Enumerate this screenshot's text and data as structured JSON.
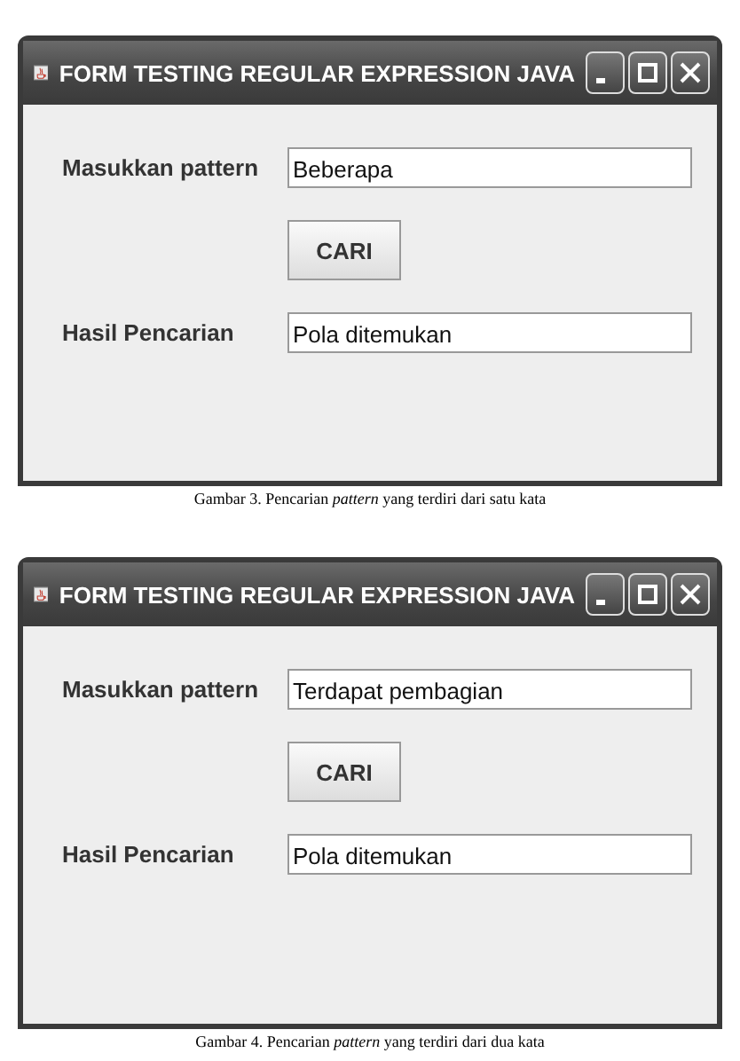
{
  "figures": [
    {
      "window": {
        "title": "FORM TESTING REGULAR EXPRESSION JAVA"
      },
      "pattern_label": "Masukkan pattern",
      "pattern_value": "Beberapa",
      "button": "CARI",
      "result_label": "Hasil Pencarian",
      "result_value": "Pola ditemukan",
      "caption": "Gambar 3. Pencarian *pattern* yang terdiri dari satu kata"
    },
    {
      "window": {
        "title": "FORM TESTING REGULAR EXPRESSION JAVA"
      },
      "pattern_label": "Masukkan pattern",
      "pattern_value": "Terdapat pembagian",
      "button": "CARI",
      "result_label": "Hasil Pencarian",
      "result_value": "Pola ditemukan",
      "caption": "Gambar 4. Pencarian *pattern* yang terdiri dari dua kata"
    }
  ]
}
